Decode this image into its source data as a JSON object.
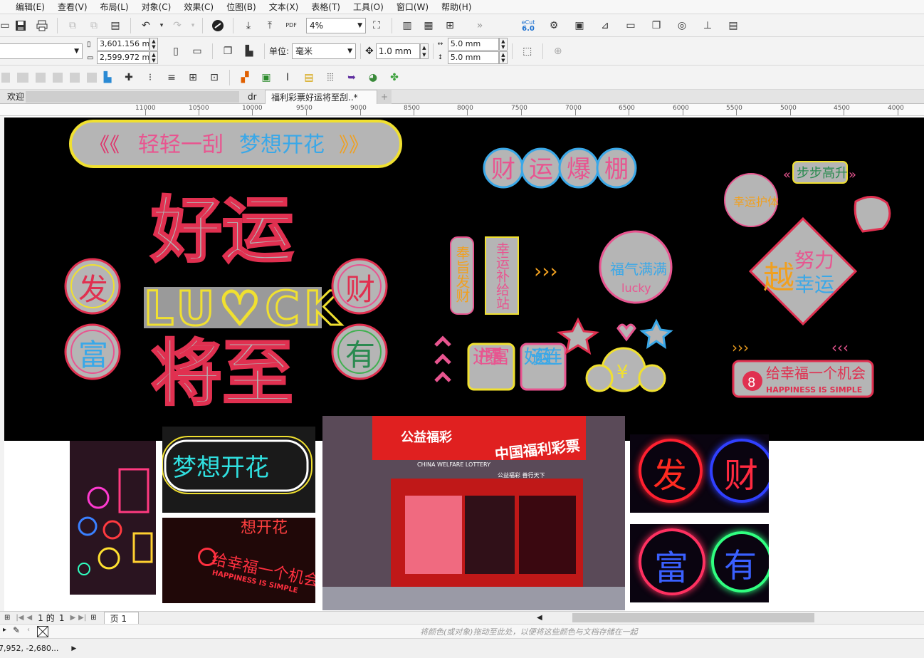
{
  "menu": [
    "编辑(E)",
    "查看(V)",
    "布局(L)",
    "对象(C)",
    "效果(C)",
    "位图(B)",
    "文本(X)",
    "表格(T)",
    "工具(O)",
    "窗口(W)",
    "帮助(H)"
  ],
  "toolbar": {
    "zoom": "4%",
    "cut_badge_top": "eCut",
    "cut_badge_bottom": "6.0",
    "pdf_label": "PDF"
  },
  "props": {
    "width": "3,601.156 mm",
    "height": "2,599.972 mm",
    "unit_label": "单位:",
    "unit_value": "毫米",
    "nudge": "1.0 mm",
    "dup_x": "5.0 mm",
    "dup_y": "5.0 mm"
  },
  "tabs": {
    "welcome": "欢迎",
    "file1_suffix": "dr",
    "active": "福利彩票好运将至刮..*",
    "add": "+"
  },
  "ruler_ticks": [
    "11000",
    "10500",
    "10000",
    "9500",
    "9000",
    "8500",
    "8000",
    "7500",
    "7000",
    "6500",
    "6000",
    "5500",
    "5000",
    "4500",
    "4000"
  ],
  "design": {
    "banner": "轻轻一刮 梦想开花",
    "banner_left": "轻轻一刮",
    "banner_right": "梦想开花",
    "title_top": "好运",
    "luck": "LU♡CK",
    "title_bottom": "将至",
    "fa": "发",
    "cai": "财",
    "fu": "富",
    "you": "有",
    "caiyun": [
      "财",
      "运",
      "爆",
      "棚"
    ],
    "fengzhi": "奉旨发财",
    "xingyun_station": "幸运补给站",
    "fuqi": "福气满满",
    "lucky": "lucky",
    "xingyun_hu": "幸运护体",
    "bubu": "步步高升",
    "yue": "越",
    "nuli": "努力",
    "xingyun": "幸运",
    "jinmen": "进门暴富",
    "haoyun_ll": "好运连连",
    "gei": "给幸福一个机会",
    "happiness": "HAPPINESS IS SIMPLE",
    "yuan": "¥",
    "eight": "8"
  },
  "photos": {
    "p2_text": "梦想开花",
    "p3_text": "给幸福一个机会",
    "p3_sub": "HAPPINESS IS SIMPLE",
    "p3_top": "想开花",
    "store_sign_left": "公益福彩",
    "store_sign_main": "中国福利彩票",
    "store_sign_en": "CHINA WELFARE LOTTERY",
    "store_strip": "公益福彩 善行天下",
    "p5_fa": "发",
    "p5_cai": "财",
    "p6_fu": "富",
    "p6_you": "有"
  },
  "pagebar": {
    "page_num": "1",
    "of": "的",
    "total": "1",
    "page_tab": "页 1"
  },
  "palette_hint": "将颜色(或对象)拖动至此处，以便将这些颜色与文档存储在一起",
  "status": {
    "coords": "-7,952, -2,680..."
  }
}
